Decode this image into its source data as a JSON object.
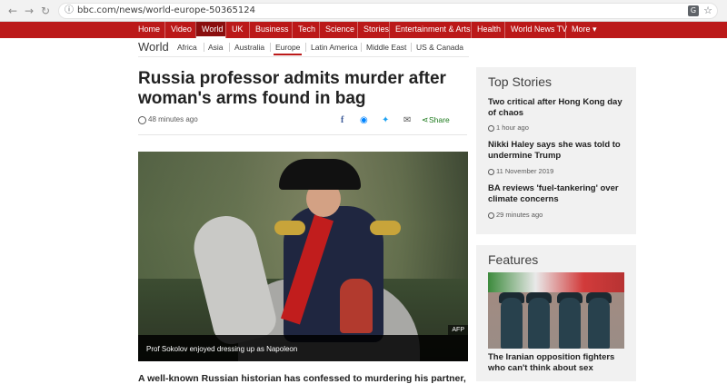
{
  "browser": {
    "url": "bbc.com/news/world-europe-50365124",
    "back_icon": "arrow-left-icon",
    "forward_icon": "arrow-right-icon",
    "reload_icon": "reload-icon"
  },
  "topnav": {
    "items": [
      "Home",
      "Video",
      "World",
      "UK",
      "Business",
      "Tech",
      "Science",
      "Stories",
      "Entertainment & Arts",
      "Health",
      "World News TV",
      "More"
    ],
    "active": "World",
    "more_arrow": "▾",
    "bg_color": "#bb1919"
  },
  "subnav": {
    "section": "World",
    "links": [
      "Africa",
      "Asia",
      "Australia",
      "Europe",
      "Latin America",
      "Middle East",
      "US & Canada"
    ],
    "active": "Europe"
  },
  "article": {
    "headline": "Russia professor admits murder after woman's arms found in bag",
    "time": "48 minutes ago",
    "share_label": "Share",
    "image_credit": "AFP",
    "image_caption": "Prof Sokolov enjoyed dressing up as Napoleon",
    "lead": "A well-known Russian historian has confessed to murdering his partner, his"
  },
  "top_stories": {
    "title": "Top Stories",
    "items": [
      {
        "title": "Two critical after Hong Kong day of chaos",
        "time": "1 hour ago"
      },
      {
        "title": "Nikki Haley says she was told to undermine Trump",
        "time": "11 November 2019"
      },
      {
        "title": "BA reviews 'fuel-tankering' over climate concerns",
        "time": "29 minutes ago"
      }
    ]
  },
  "features": {
    "title": "Features",
    "item_title": "The Iranian opposition fighters who can't think about sex"
  }
}
